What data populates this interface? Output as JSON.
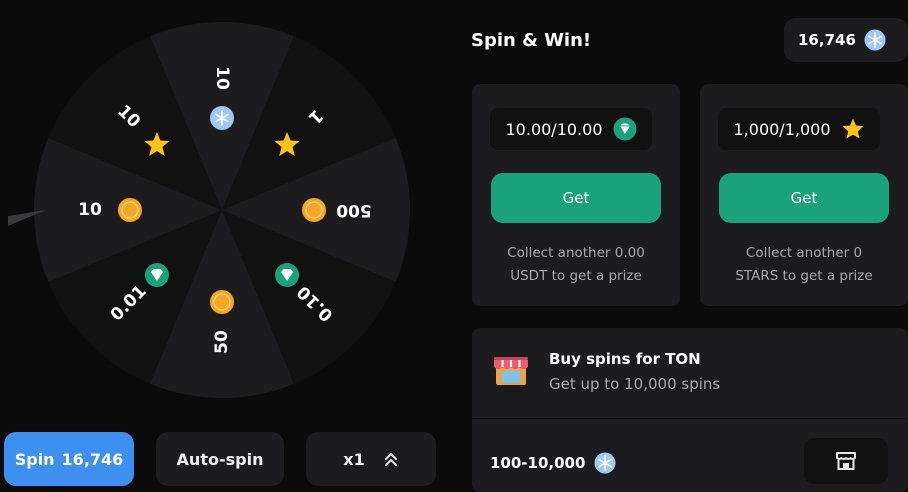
{
  "header": {
    "title": "Spin & Win!",
    "balance": "16,746",
    "balance_icon": "snowflake-coin-icon"
  },
  "wheel": {
    "segments": [
      {
        "label": "10",
        "icon": "snowflake-coin-icon"
      },
      {
        "label": "1",
        "icon": "star-icon"
      },
      {
        "label": "500",
        "icon": "coin-icon"
      },
      {
        "label": "0.10",
        "icon": "usdt-icon"
      },
      {
        "label": "50",
        "icon": "coin-icon"
      },
      {
        "label": "0.01",
        "icon": "usdt-icon"
      },
      {
        "label": "10",
        "icon": "coin-icon"
      },
      {
        "label": "10",
        "icon": "star-icon"
      }
    ],
    "colors": {
      "light": "#1c1c1e",
      "dark": "#111112",
      "coin": "#f5a623",
      "star": "#ffc21a",
      "usdt": "#1aa37a",
      "snow": "#9ec9f5"
    }
  },
  "controls": {
    "spin_label": "Spin",
    "spin_count": "16,746",
    "auto_label": "Auto-spin",
    "multiplier": "x1"
  },
  "cards": [
    {
      "amount": "10.00/10.00",
      "icon": "usdt-diamond-icon",
      "button": "Get",
      "note_line1": "Collect another 0.00",
      "note_line2": "USDT to get a prize"
    },
    {
      "amount": "1,000/1,000",
      "icon": "star-icon",
      "button": "Get",
      "note_line1": "Collect another 0",
      "note_line2": "STARS to get a prize"
    }
  ],
  "buy": {
    "title": "Buy spins for TON",
    "subtitle": "Get up to 10,000 spins",
    "range": "100-10,000",
    "range_icon": "snowflake-coin-icon"
  },
  "theme": {
    "accent_blue": "#3e8ff0",
    "accent_green": "#1aa37a"
  }
}
